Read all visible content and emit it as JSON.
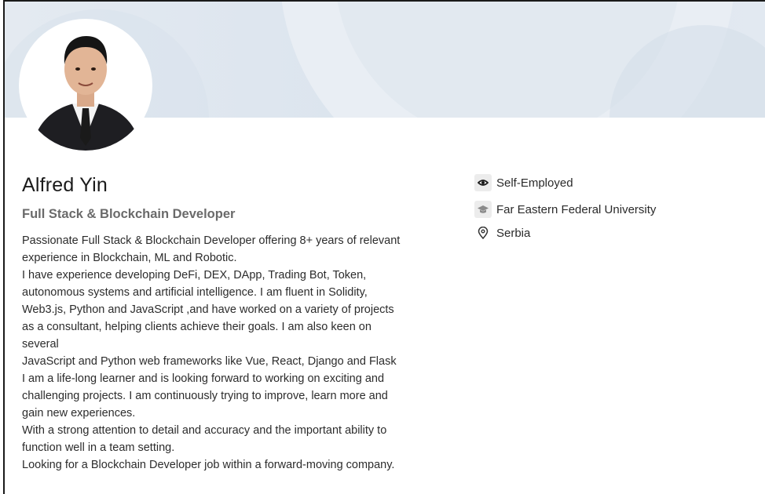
{
  "profile": {
    "name": "Alfred Yin",
    "headline": "Full Stack & Blockchain Developer",
    "about_lines": [
      "Passionate Full Stack & Blockchain Developer offering 8+ years of relevant",
      "experience in Blockchain, ML and Robotic.",
      "I have experience developing DeFi, DEX, DApp, Trading Bot, Token,",
      "autonomous systems and artificial intelligence. I am fluent in Solidity,",
      "Web3.js, Python and JavaScript ,and have worked on a variety of projects",
      "as a consultant, helping clients achieve their goals. I am also keen on",
      "several",
      "JavaScript and Python web frameworks like Vue, React, Django and Flask",
      "I am a life-long learner and is looking forward to working on exciting and",
      "challenging projects. I am continuously trying to improve, learn more and",
      "gain new experiences.",
      "With a strong attention to detail and accuracy and the important ability to",
      "function well in a team setting.",
      "Looking for a Blockchain Developer job within a forward-moving company."
    ]
  },
  "sidebar": {
    "employment": {
      "label": "Self-Employed",
      "icon": "briefcase-icon"
    },
    "education": {
      "label": "Far Eastern Federal University",
      "icon": "graduation-cap-icon"
    },
    "location": {
      "label": "Serbia",
      "icon": "location-pin-icon"
    }
  },
  "colors": {
    "banner": "#dfe7ef",
    "text_primary": "#1b1b1b",
    "text_secondary": "#6a6a6a"
  }
}
